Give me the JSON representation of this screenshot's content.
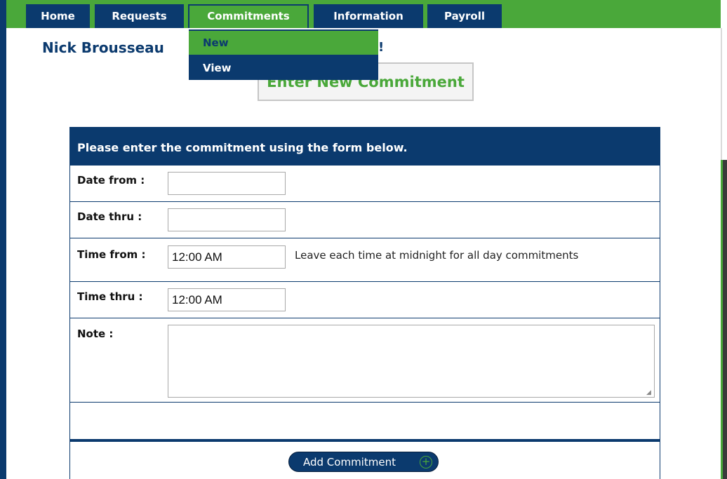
{
  "nav": {
    "items": [
      {
        "label": "Home"
      },
      {
        "label": "Requests"
      },
      {
        "label": "Commitments"
      },
      {
        "label": "Information"
      },
      {
        "label": "Payroll"
      }
    ],
    "dropdown": [
      {
        "label": "New"
      },
      {
        "label": "View"
      }
    ]
  },
  "header": {
    "user_name": "Nick Brousseau",
    "title_tail": "!",
    "page_title": "Enter New Commitment"
  },
  "form": {
    "heading": "Please enter the commitment using the form below.",
    "date_from_label": "Date from :",
    "date_from_value": "",
    "date_thru_label": "Date thru :",
    "date_thru_value": "",
    "time_from_label": "Time from :",
    "time_from_value": "12:00 AM",
    "time_hint": "Leave each time at midnight for all day commitments",
    "time_thru_label": "Time thru :",
    "time_thru_value": "12:00 AM",
    "note_label": "Note :",
    "note_value": "",
    "submit_label": "Add Commitment"
  },
  "colors": {
    "navy": "#0b3a6e",
    "green": "#4aa83a"
  }
}
